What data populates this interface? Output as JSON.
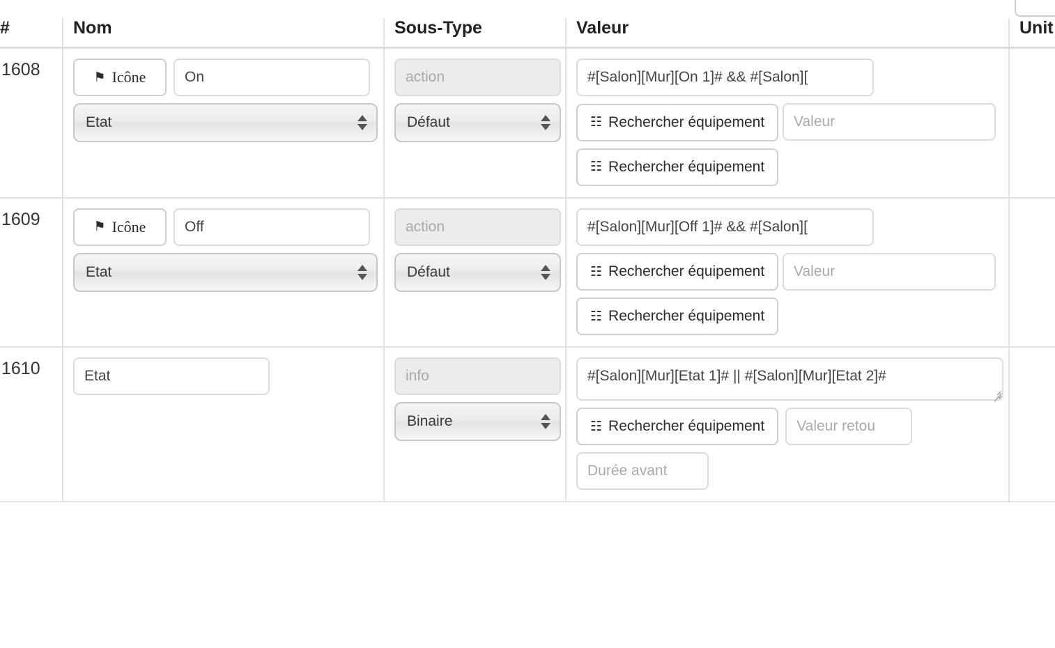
{
  "top_partial_widget": {
    "present": true
  },
  "table": {
    "headers": {
      "num": "#",
      "nom": "Nom",
      "sous_type": "Sous-Type",
      "valeur": "Valeur",
      "unite": "Unit"
    },
    "rows": [
      {
        "id": "1608",
        "nom": {
          "icon_button_label": "Icône",
          "icon_glyph": "⚑",
          "name_value": "On",
          "type_select_value": "Etat"
        },
        "sous_type": {
          "action_placeholder": "action",
          "subtype_select_value": "Défaut"
        },
        "valeur": {
          "expression_value": "#[Salon][Mur][On 1]# && #[Salon][",
          "search_button_1": "Rechercher équipement",
          "value_placeholder": "Valeur",
          "search_button_2": "Rechercher équipement"
        },
        "unite": ""
      },
      {
        "id": "1609",
        "nom": {
          "icon_button_label": "Icône",
          "icon_glyph": "⚑",
          "name_value": "Off",
          "type_select_value": "Etat"
        },
        "sous_type": {
          "action_placeholder": "action",
          "subtype_select_value": "Défaut"
        },
        "valeur": {
          "expression_value": "#[Salon][Mur][Off 1]# && #[Salon][",
          "search_button_1": "Rechercher équipement",
          "value_placeholder": "Valeur",
          "search_button_2": "Rechercher équipement"
        },
        "unite": ""
      },
      {
        "id": "1610",
        "nom": {
          "name_value": "Etat"
        },
        "sous_type": {
          "info_placeholder": "info",
          "subtype_select_value": "Binaire"
        },
        "valeur": {
          "expression_value": "#[Salon][Mur][Etat 1]# || #[Salon][Mur][Etat 2]#",
          "search_button_1": "Rechercher équipement",
          "return_value_placeholder": "Valeur retou",
          "duration_placeholder": "Durée avant"
        },
        "unite": ""
      }
    ]
  },
  "icons": {
    "flag": "flag-icon",
    "list": "list-alt-icon"
  },
  "colors": {
    "text": "#333333",
    "border": "#e2e2e2",
    "input_border": "#dcdcdc",
    "disabled_bg": "#ececec",
    "placeholder": "#a9a9a9"
  }
}
